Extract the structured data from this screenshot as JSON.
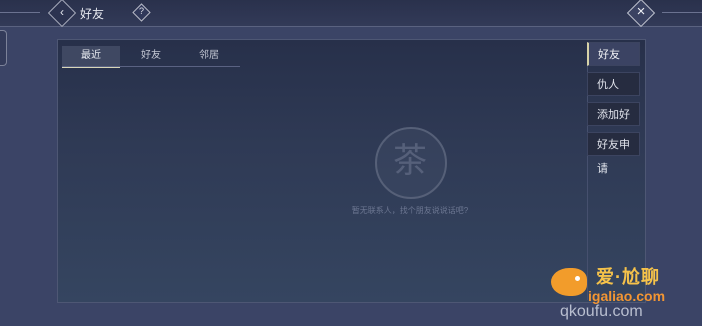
{
  "header": {
    "title": "好友",
    "back_icon": "chevron-left-icon",
    "help_icon": "help-icon",
    "close_icon": "close-icon"
  },
  "tabs": [
    {
      "label": "最近",
      "active": true
    },
    {
      "label": "好友",
      "active": false
    },
    {
      "label": "邻居",
      "active": false
    }
  ],
  "empty_state": {
    "message": "暂无联系人，找个朋友说说话吧?"
  },
  "side_menu": [
    {
      "label": "好友",
      "active": true
    },
    {
      "label": "仇人",
      "active": false
    },
    {
      "label": "添加好友",
      "active": false
    },
    {
      "label": "好友申请",
      "active": false
    }
  ],
  "watermark": {
    "top": "爱·尬聊",
    "url": "igaliao.com",
    "bottom": "qkoufu.com"
  },
  "colors": {
    "accent": "#d9d7b8",
    "background": "#3b4466",
    "panel": "#2f3a55"
  }
}
